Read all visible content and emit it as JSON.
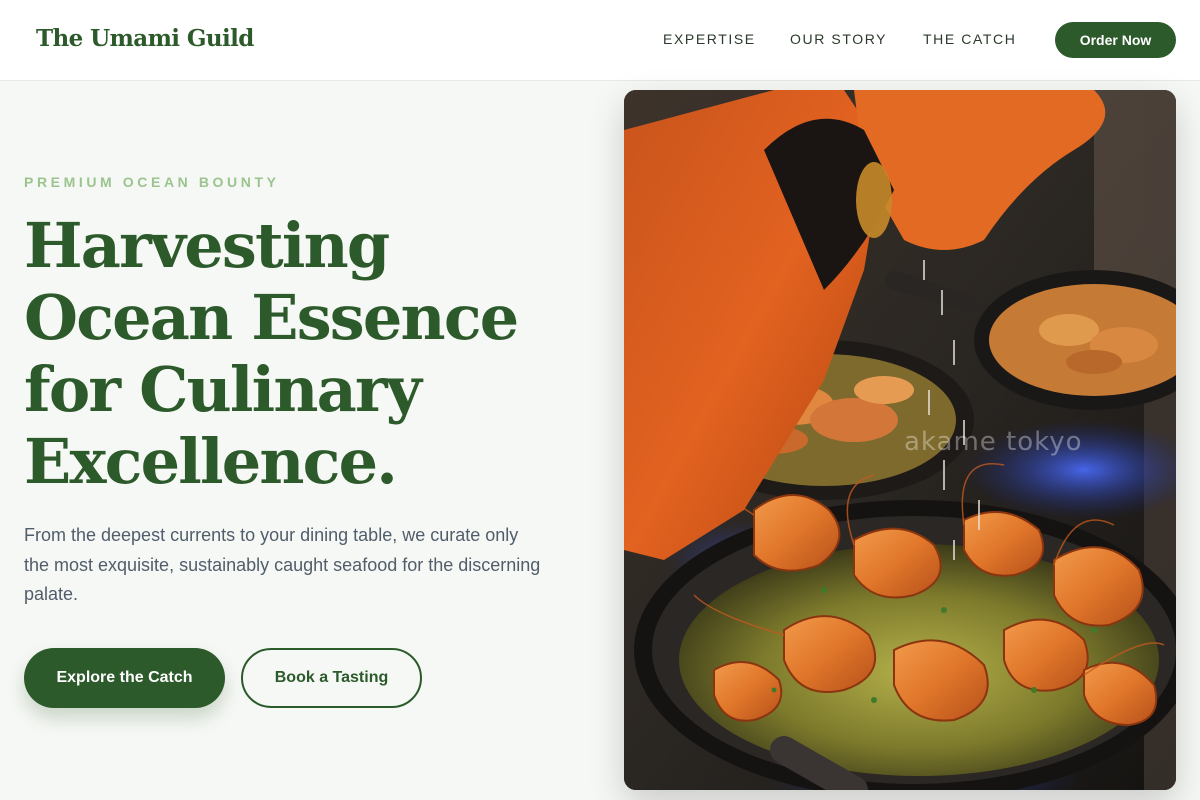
{
  "header": {
    "logo": "The Umami Guild",
    "nav": [
      {
        "label": "EXPERTISE"
      },
      {
        "label": "OUR STORY"
      },
      {
        "label": "THE CATCH"
      }
    ],
    "cta_label": "Order Now"
  },
  "hero": {
    "eyebrow": "PREMIUM OCEAN BOUNTY",
    "headline_lines": [
      "Harvesting",
      "Ocean Essence",
      "for Culinary",
      "Excellence."
    ],
    "lead": "From the deepest currents to your dining table, we curate only the most exquisite, sustainably caught seafood for the discerning palate.",
    "primary_button": "Explore the Catch",
    "secondary_button": "Book a Tasting",
    "image_watermark": "akame tokyo"
  },
  "colors": {
    "brand_green": "#2d5a2b",
    "eyebrow_green": "#9bc48e",
    "body_text": "#515d6a",
    "page_background": "#f6f8f5"
  }
}
